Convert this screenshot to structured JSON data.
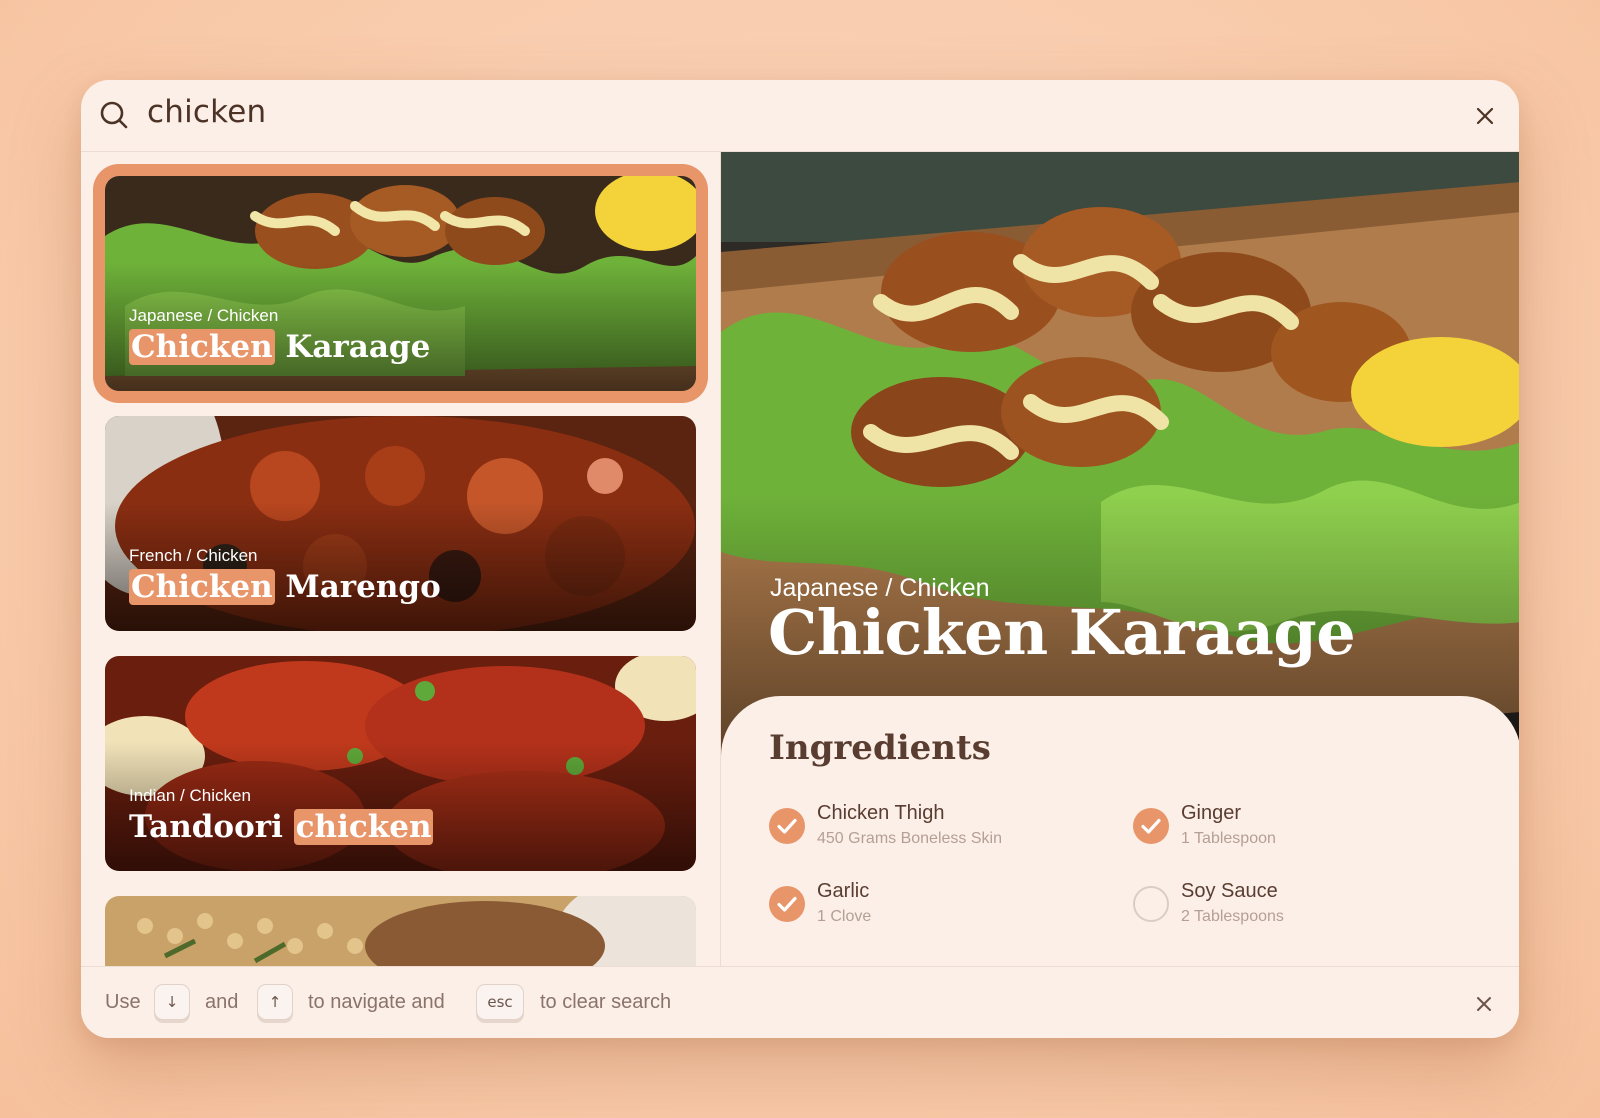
{
  "search": {
    "query": "chicken"
  },
  "results": [
    {
      "category": "Japanese / Chicken",
      "title_highlight": "Chicken",
      "title_rest": " Karaage",
      "selected": true
    },
    {
      "category": "French / Chicken",
      "title_highlight": "Chicken",
      "title_rest": " Marengo",
      "selected": false
    },
    {
      "category": "Indian / Chicken",
      "title_pre": "Tandoori ",
      "title_highlight": "chicken",
      "selected": false
    },
    {
      "category": "",
      "title_highlight": "",
      "title_rest": "",
      "selected": false
    }
  ],
  "detail": {
    "category": "Japanese / Chicken",
    "title": "Chicken Karaage",
    "ingredients_heading": "Ingredients",
    "ingredients": [
      {
        "name": "Chicken Thigh",
        "qty": "450 Grams Boneless Skin",
        "checked": true
      },
      {
        "name": "Ginger",
        "qty": "1 Tablespoon",
        "checked": true
      },
      {
        "name": "Garlic",
        "qty": "1 Clove",
        "checked": true
      },
      {
        "name": "Soy Sauce",
        "qty": "2 Tablespoons",
        "checked": false
      }
    ]
  },
  "footer": {
    "use": "Use",
    "and": "and",
    "navigate": "to navigate and",
    "clear": "to clear search",
    "key_down": "↓",
    "key_up": "↑",
    "key_esc": "esc"
  },
  "colors": {
    "accent": "#e8956a",
    "text": "#5a3d31",
    "muted": "#b59f94",
    "panel": "#fbefe8"
  },
  "icons": {
    "search": "search-icon",
    "close": "close-icon",
    "check": "check-icon"
  }
}
